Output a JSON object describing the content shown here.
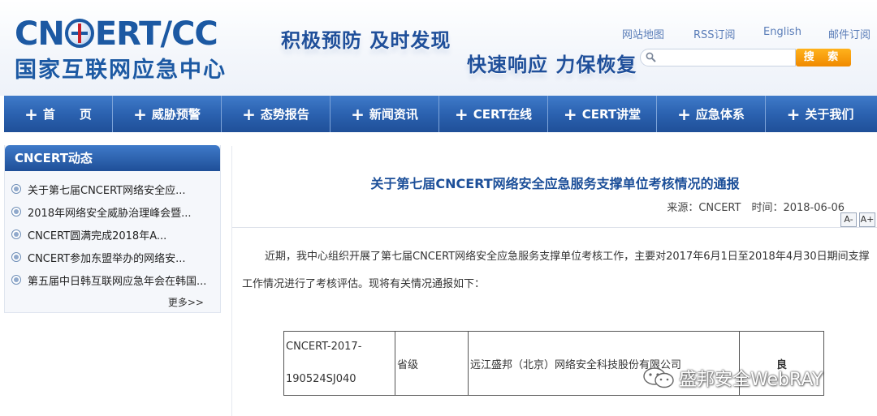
{
  "header": {
    "logo_top": [
      "CN",
      "ERT/CC"
    ],
    "logo_bottom": "国家互联网应急中心",
    "slogan1": "积极预防 及时发现",
    "slogan2": "快速响应 力保恢复",
    "top_links": [
      "网站地图",
      "RSS订阅",
      "English",
      "邮件订阅"
    ],
    "search_placeholder": "",
    "search_button": "搜 索"
  },
  "nav": [
    "首　　页",
    "威胁预警",
    "态势报告",
    "新闻资讯",
    "CERT在线",
    "CERT讲堂",
    "应急体系",
    "关于我们"
  ],
  "sidebar": {
    "title": "CNCERT动态",
    "items": [
      "关于第七届CNCERT网络安全应...",
      "2018年网络安全威胁治理峰会暨...",
      "CNCERT圆满完成2018年A...",
      "CNCERT参加东盟举办的网络安...",
      "第五届中日韩互联网应急年会在韩国..."
    ],
    "more": "更多>>"
  },
  "article": {
    "title": "关于第七届CNCERT网络安全应急服务支撑单位考核情况的通报",
    "meta": "来源：CNCERT　时间：2018-06-06",
    "font_smaller": "A-",
    "font_larger": "A+",
    "paragraph_line1": "近期，我中心组织开展了第七届CNCERT网络安全应急服务支撑单位考核工作，主要对2017年6月1日至2018年4月30日期间支撑",
    "paragraph_line2": "工作情况进行了考核评估。现将有关情况通报如下：",
    "table": {
      "id_line1": "CNCERT-2017-",
      "id_line2": "190524SJ040",
      "level": "省级",
      "company": "远江盛邦（北京）网络安全科技股份有限公司",
      "grade": "良"
    }
  },
  "watermark": {
    "text": "盛邦安全WebRAY",
    "icon": "wechat-icon"
  }
}
